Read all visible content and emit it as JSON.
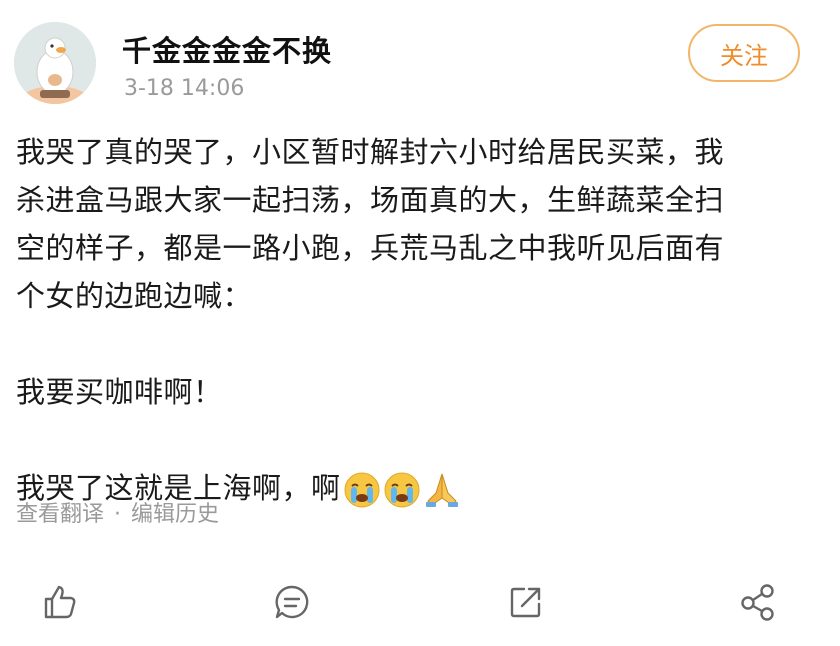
{
  "post": {
    "author": "千金金金金不换",
    "timestamp": "3-18 14:06",
    "follow_label": "关注",
    "paragraphs": [
      "我哭了真的哭了，小区暂时解封六小时给居民买菜，我",
      "杀进盒马跟大家一起扫荡，场面真的大，生鲜蔬菜全扫",
      "空的样子，都是一路小跑，兵荒马乱之中我听见后面有",
      "个女的边跑边喊："
    ],
    "quote": "我要买咖啡啊！",
    "closing": "我哭了这就是上海啊，啊",
    "emojis": [
      "crying-face-icon",
      "crying-face-icon",
      "praying-hands-icon"
    ]
  },
  "links": {
    "translate": "查看翻译",
    "separator": "·",
    "edit_history": "编辑历史"
  },
  "actions": [
    "like-icon",
    "comment-icon",
    "share-icon",
    "more-share-icon"
  ],
  "colors": {
    "accent": "#f08c2a",
    "muted": "#9a9a9a",
    "text": "#1a1a1a"
  }
}
